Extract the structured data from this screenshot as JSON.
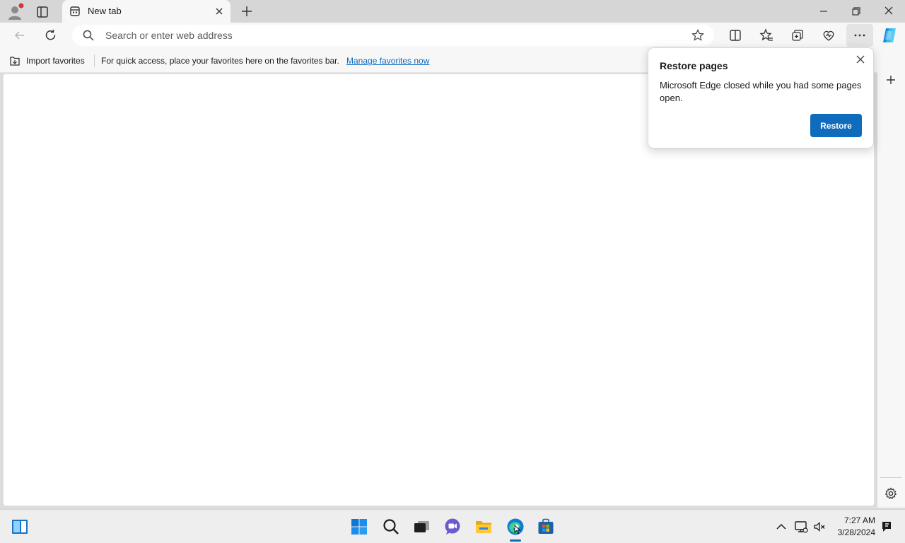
{
  "browser": {
    "tab": {
      "title": "New tab"
    },
    "address_bar": {
      "placeholder": "Search or enter web address"
    }
  },
  "favorites_bar": {
    "import_label": "Import favorites",
    "hint": "For quick access, place your favorites here on the favorites bar.",
    "manage_link": "Manage favorites now"
  },
  "restore_popup": {
    "title": "Restore pages",
    "message": "Microsoft Edge closed while you had some pages open.",
    "button_label": "Restore"
  },
  "taskbar": {
    "time": "7:27 AM",
    "date": "3/28/2024"
  },
  "colors": {
    "accent": "#0f6cbd",
    "profile_badge": "#d13438"
  },
  "icons": {
    "tabstrip": [
      "profile-icon",
      "tab-actions-icon",
      "new-tab-page-icon",
      "close-icon",
      "plus-icon",
      "minimize-icon",
      "restore-window-icon",
      "close-window-icon"
    ],
    "toolbar": [
      "back-icon",
      "refresh-icon",
      "search-icon",
      "star-icon",
      "split-screen-icon",
      "favorites-icon",
      "collections-icon",
      "browser-essentials-icon",
      "more-icon",
      "copilot-icon"
    ],
    "sidebar": [
      "plus-icon",
      "gear-icon"
    ],
    "taskbar": [
      "widgets-icon",
      "start-icon",
      "search-icon",
      "task-view-icon",
      "teams-chat-icon",
      "file-explorer-icon",
      "edge-icon",
      "store-icon",
      "chevron-up-icon",
      "network-icon",
      "volume-muted-icon",
      "notification-icon"
    ]
  }
}
